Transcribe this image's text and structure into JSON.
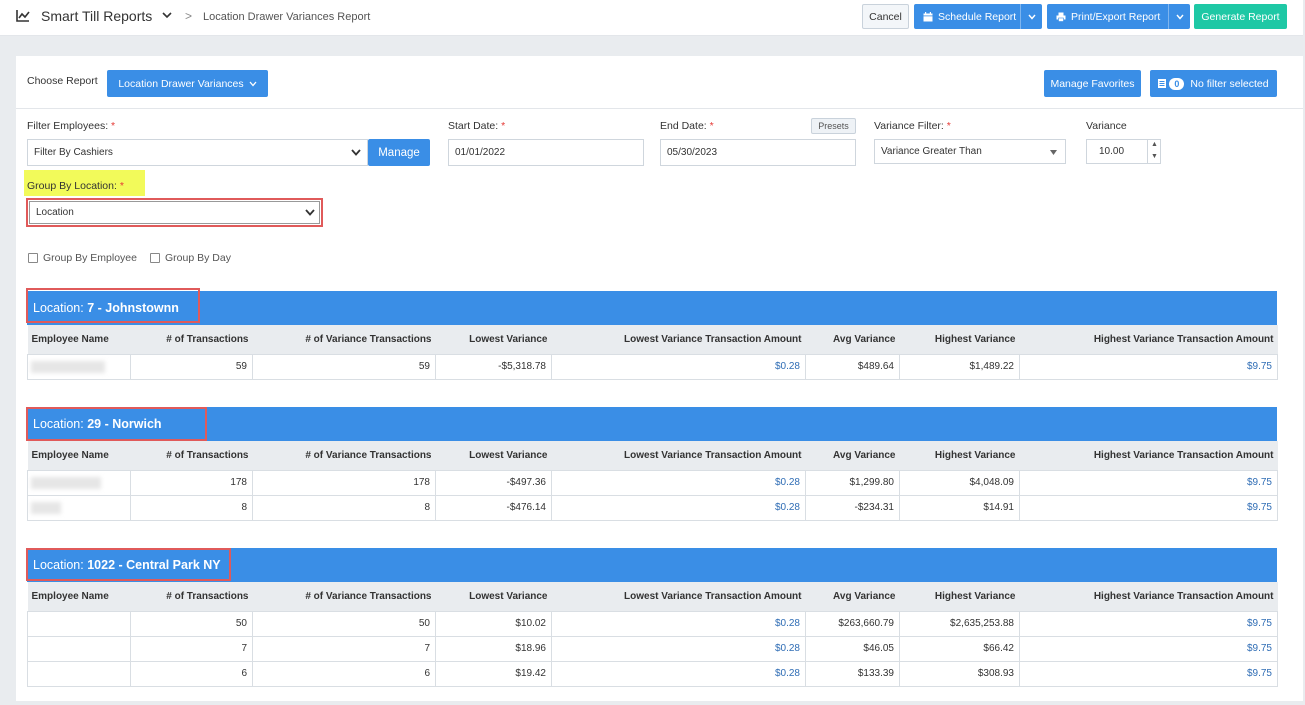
{
  "topbar": {
    "title": "Smart Till Reports",
    "crumb_separator": ">",
    "breadcrumb": "Location Drawer Variances Report",
    "cancel_label": "Cancel",
    "schedule_label": "Schedule Report",
    "print_label": "Print/Export Report",
    "generate_label": "Generate Report"
  },
  "panel": {
    "choose_label": "Choose Report",
    "report_select_label": "Location Drawer Variances",
    "favorites_label": "Manage Favorites",
    "filter_count": "0",
    "no_filter_label": "No filter selected"
  },
  "filters": {
    "employees_label": "Filter Employees:",
    "employees_value": "Filter By Cashiers",
    "manage_label": "Manage",
    "start_label": "Start Date:",
    "start_value": "01/01/2022",
    "end_label": "End Date:",
    "end_value": "05/30/2023",
    "presets_label": "Presets",
    "variance_filter_label": "Variance Filter:",
    "variance_filter_value": "Variance Greater Than",
    "variance_label": "Variance",
    "variance_value": "10.00",
    "group_location_label": "Group By Location:",
    "group_location_value": "Location",
    "group_employee_label": "Group By Employee",
    "group_day_label": "Group By Day",
    "required_mark": "*"
  },
  "columns": [
    "Employee Name",
    "# of Transactions",
    "# of Variance Transactions",
    "Lowest Variance",
    "Lowest Variance Transaction Amount",
    "Avg Variance",
    "Highest Variance",
    "Highest Variance Transaction Amount"
  ],
  "locations": [
    {
      "prefix": "Location:",
      "name": "7 - Johnstownn",
      "rows": [
        [
          "",
          "59",
          "59",
          "-$5,318.78",
          "$0.28",
          "$489.64",
          "$1,489.22",
          "$9.75"
        ]
      ]
    },
    {
      "prefix": "Location:",
      "name": "29 - Norwich",
      "rows": [
        [
          "",
          "178",
          "178",
          "-$497.36",
          "$0.28",
          "$1,299.80",
          "$4,048.09",
          "$9.75"
        ],
        [
          "",
          "8",
          "8",
          "-$476.14",
          "$0.28",
          "-$234.31",
          "$14.91",
          "$9.75"
        ]
      ]
    },
    {
      "prefix": "Location:",
      "name": "1022 - Central Park NY",
      "rows": [
        [
          "",
          "50",
          "50",
          "$10.02",
          "$0.28",
          "$263,660.79",
          "$2,635,253.88",
          "$9.75"
        ],
        [
          "",
          "7",
          "7",
          "$18.96",
          "$0.28",
          "$46.05",
          "$66.42",
          "$9.75"
        ],
        [
          "",
          "6",
          "6",
          "$19.42",
          "$0.28",
          "$133.39",
          "$308.93",
          "$9.75"
        ]
      ]
    }
  ],
  "colors": {
    "accent": "#3a8ee6",
    "generate": "#1ec8a5",
    "highlight": "#f2fa5a",
    "annotation": "#e05a5a"
  }
}
